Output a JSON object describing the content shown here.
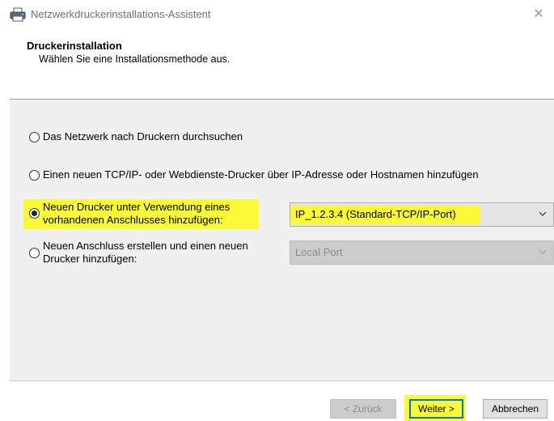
{
  "window": {
    "title": "Netzwerkdruckerinstallations-Assistent",
    "close_glyph": "✕",
    "icon": "printer-icon"
  },
  "header": {
    "title": "Druckerinstallation",
    "subtitle": "Wählen Sie eine Installationsmethode aus."
  },
  "options": {
    "search_network": "Das Netzwerk nach Druckern durchsuchen",
    "tcpip": "Einen neuen TCP/IP- oder Webdienste-Drucker über IP-Adresse oder Hostnamen hinzufügen",
    "existing_port_line1": "Neuen Drucker unter Verwendung eines",
    "existing_port_line2": "vorhandenen Anschlusses hinzufügen:",
    "new_port_line1": "Neuen Anschluss erstellen und einen neuen",
    "new_port_line2": "Drucker hinzufügen:",
    "selected": "existing_port"
  },
  "existing_port_select": {
    "value": "IP_1.2.3.4 (Standard-TCP/IP-Port)",
    "enabled": true
  },
  "new_port_select": {
    "value": "Local Port",
    "enabled": false
  },
  "buttons": {
    "back": "< Zurück",
    "next": "Weiter >",
    "cancel": "Abbrechen"
  },
  "colors": {
    "highlight": "#fafa36",
    "panel_bg": "#f0f0f0",
    "disabled_text": "#8c8c8c",
    "disabled_bg": "#cccccc",
    "default_button_border": "#0078d7"
  }
}
